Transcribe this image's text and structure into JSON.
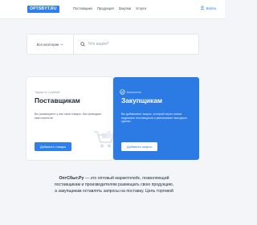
{
  "header": {
    "logo": "OPTSBYT.RU",
    "nav": [
      "Поставщики",
      "Продукция",
      "Закупки",
      "Услуги"
    ],
    "login_label": "Войти"
  },
  "search": {
    "category": "Все категории",
    "placeholder": "Что ищем?"
  },
  "supplier_card": {
    "tag": "Тариф от 0 рублей",
    "title": "Поставщикам",
    "description": "Вы размещаете у нас свои товары. Мы приводим вам клиентов.",
    "button": "Добавить товары"
  },
  "buyer_card": {
    "tag": "Бесплатно",
    "title": "Закупщикам",
    "description": "Вы добавляете запрос, который через новые надежные поставщиков и увеличивает выгодные сделки.",
    "button": "Добавить запрос"
  },
  "about": {
    "brand": "ОптСбыт.Ру",
    "text": " — это оптовый маркетплейс, позволяющий поставщикам и производителям размещать свою продукцию, а закупщикам оставлять запросы на поставку. Цель торговой"
  },
  "colors": {
    "accent": "#2f80ed",
    "buyer_card": "#2c7be5",
    "background": "#f3f5f9"
  },
  "icons": [
    "user-icon",
    "chevron-down-icon",
    "search-icon",
    "cart-icon",
    "badge-icon"
  ]
}
